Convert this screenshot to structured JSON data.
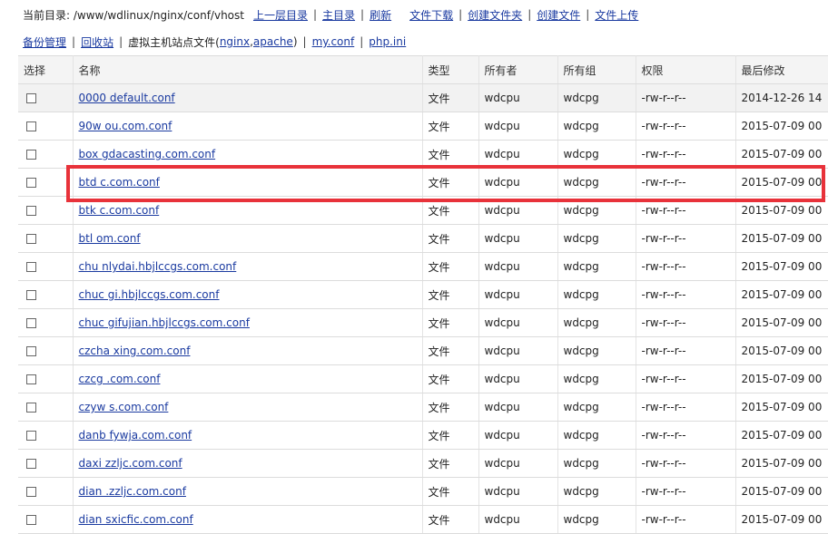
{
  "topbar": {
    "path_label": "当前目录: /www/wdlinux/nginx/conf/vhost",
    "links": [
      "上一层目录",
      "主目录",
      "刷新",
      "文件下载",
      "创建文件夹",
      "创建文件",
      "文件上传"
    ]
  },
  "subbar": {
    "backup": "备份管理",
    "recycle": "回收站",
    "vhost_prefix": "虚拟主机站点文件(",
    "nginx": "nginx",
    "comma": ",",
    "apache": "apache",
    "vhost_suffix": ")",
    "myconf": "my.conf",
    "phpini": "php.ini"
  },
  "table": {
    "headers": [
      "选择",
      "名称",
      "类型",
      "所有者",
      "所有组",
      "权限",
      "最后修改"
    ],
    "rows": [
      {
        "name": "0000 default.conf",
        "type": "文件",
        "owner": "wdcpu",
        "group": "wdcpg",
        "perm": "-rw-r--r--",
        "mtime": "2014-12-26 14"
      },
      {
        "name": "90w ou.com.conf",
        "type": "文件",
        "owner": "wdcpu",
        "group": "wdcpg",
        "perm": "-rw-r--r--",
        "mtime": "2015-07-09 00"
      },
      {
        "name": "box gdacasting.com.conf",
        "type": "文件",
        "owner": "wdcpu",
        "group": "wdcpg",
        "perm": "-rw-r--r--",
        "mtime": "2015-07-09 00"
      },
      {
        "name": "btd c.com.conf",
        "type": "文件",
        "owner": "wdcpu",
        "group": "wdcpg",
        "perm": "-rw-r--r--",
        "mtime": "2015-07-09 00"
      },
      {
        "name": "btk c.com.conf",
        "type": "文件",
        "owner": "wdcpu",
        "group": "wdcpg",
        "perm": "-rw-r--r--",
        "mtime": "2015-07-09 00"
      },
      {
        "name": "btl om.conf",
        "type": "文件",
        "owner": "wdcpu",
        "group": "wdcpg",
        "perm": "-rw-r--r--",
        "mtime": "2015-07-09 00"
      },
      {
        "name": "chu nlydai.hbjlccgs.com.conf",
        "type": "文件",
        "owner": "wdcpu",
        "group": "wdcpg",
        "perm": "-rw-r--r--",
        "mtime": "2015-07-09 00"
      },
      {
        "name": "chuc gi.hbjlccgs.com.conf",
        "type": "文件",
        "owner": "wdcpu",
        "group": "wdcpg",
        "perm": "-rw-r--r--",
        "mtime": "2015-07-09 00"
      },
      {
        "name": "chuc gifujian.hbjlccgs.com.conf",
        "type": "文件",
        "owner": "wdcpu",
        "group": "wdcpg",
        "perm": "-rw-r--r--",
        "mtime": "2015-07-09 00"
      },
      {
        "name": "czcha xing.com.conf",
        "type": "文件",
        "owner": "wdcpu",
        "group": "wdcpg",
        "perm": "-rw-r--r--",
        "mtime": "2015-07-09 00"
      },
      {
        "name": "czcg .com.conf",
        "type": "文件",
        "owner": "wdcpu",
        "group": "wdcpg",
        "perm": "-rw-r--r--",
        "mtime": "2015-07-09 00"
      },
      {
        "name": "czyw s.com.conf",
        "type": "文件",
        "owner": "wdcpu",
        "group": "wdcpg",
        "perm": "-rw-r--r--",
        "mtime": "2015-07-09 00"
      },
      {
        "name": "danb fywja.com.conf",
        "type": "文件",
        "owner": "wdcpu",
        "group": "wdcpg",
        "perm": "-rw-r--r--",
        "mtime": "2015-07-09 00"
      },
      {
        "name": "daxi zzljc.com.conf",
        "type": "文件",
        "owner": "wdcpu",
        "group": "wdcpg",
        "perm": "-rw-r--r--",
        "mtime": "2015-07-09 00"
      },
      {
        "name": "dian .zzljc.com.conf",
        "type": "文件",
        "owner": "wdcpu",
        "group": "wdcpg",
        "perm": "-rw-r--r--",
        "mtime": "2015-07-09 00"
      },
      {
        "name": "dian sxicfic.com.conf",
        "type": "文件",
        "owner": "wdcpu",
        "group": "wdcpg",
        "perm": "-rw-r--r--",
        "mtime": "2015-07-09 00"
      }
    ]
  },
  "colors": {
    "link": "#1a3aa0",
    "highlight": "#e8323a"
  }
}
